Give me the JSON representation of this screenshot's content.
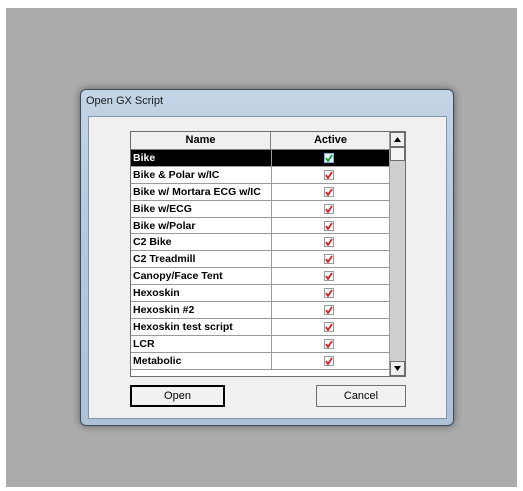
{
  "dialog": {
    "title": "Open GX Script"
  },
  "list": {
    "columns": [
      "Name",
      "Active"
    ],
    "rows": [
      {
        "name": "Bike",
        "active": true,
        "selected": true
      },
      {
        "name": "Bike & Polar w/IC",
        "active": true
      },
      {
        "name": "Bike w/ Mortara ECG w/IC",
        "active": true
      },
      {
        "name": "Bike w/ECG",
        "active": true
      },
      {
        "name": "Bike w/Polar",
        "active": true
      },
      {
        "name": "C2 Bike",
        "active": true
      },
      {
        "name": "C2 Treadmill",
        "active": true
      },
      {
        "name": "Canopy/Face Tent",
        "active": true
      },
      {
        "name": "Hexoskin",
        "active": true
      },
      {
        "name": "Hexoskin #2",
        "active": true
      },
      {
        "name": "Hexoskin test script",
        "active": true
      },
      {
        "name": "LCR",
        "active": true
      },
      {
        "name": "Metabolic",
        "active": true
      }
    ]
  },
  "buttons": {
    "open": "Open",
    "cancel": "Cancel"
  },
  "colors": {
    "check_mark": "#d42020",
    "check_mark_selected": "#1a9a3a",
    "selected_row_bg": "#000000"
  },
  "icons": {
    "check": "checkbox-checked-icon",
    "scroll_up": "arrow-up-icon",
    "scroll_down": "arrow-down-icon"
  }
}
